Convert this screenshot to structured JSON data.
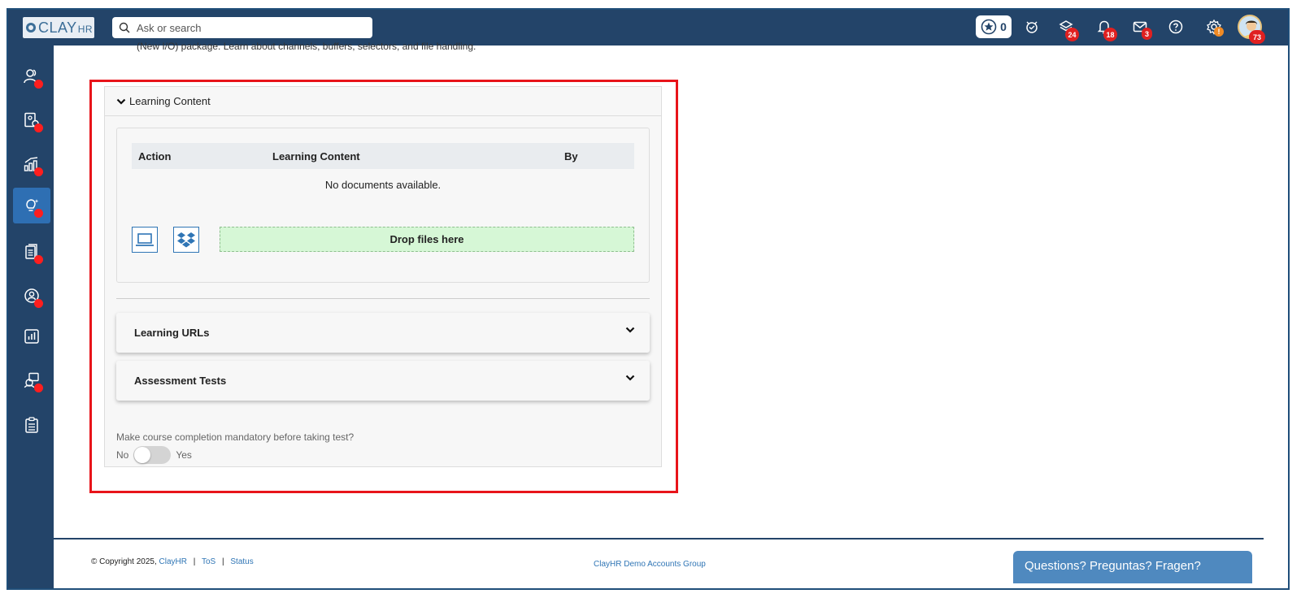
{
  "app": {
    "logo_text": "CLAY",
    "logo_suffix": "HR"
  },
  "search": {
    "placeholder": "Ask or search",
    "value": ""
  },
  "topbar": {
    "star_count": "0",
    "icons": [
      {
        "name": "alarm-icon",
        "badge": ""
      },
      {
        "name": "layers-icon",
        "badge": "24"
      },
      {
        "name": "bell-icon",
        "badge": "18"
      },
      {
        "name": "mail-icon",
        "badge": "3"
      },
      {
        "name": "help-icon",
        "badge": ""
      },
      {
        "name": "settings-icon",
        "badge": "!"
      }
    ],
    "avatar_badge": "73"
  },
  "sidebar": {
    "items": [
      {
        "name": "people-icon",
        "dot": true,
        "active": false
      },
      {
        "name": "document-person-icon",
        "dot": true,
        "active": false
      },
      {
        "name": "growth-chart-icon",
        "dot": true,
        "active": false
      },
      {
        "name": "learning-bulb-icon",
        "dot": true,
        "active": true
      },
      {
        "name": "documents-icon",
        "dot": true,
        "active": false
      },
      {
        "name": "user-circle-icon",
        "dot": true,
        "active": false
      },
      {
        "name": "report-chart-icon",
        "dot": false,
        "active": false
      },
      {
        "name": "support-chat-icon",
        "dot": true,
        "active": false
      },
      {
        "name": "clipboard-icon",
        "dot": false,
        "active": false
      }
    ]
  },
  "content": {
    "cut_text": "(New I/O) package. Learn about channels, buffers, selectors, and file handling.",
    "learning_content": {
      "title": "Learning Content",
      "columns": [
        "Action",
        "Learning Content",
        "By"
      ],
      "empty_message": "No documents available.",
      "drop_label": "Drop files here"
    },
    "learning_urls_title": "Learning URLs",
    "assessment_tests_title": "Assessment Tests",
    "mandatory_question": "Make course completion mandatory before taking test?",
    "toggle_no": "No",
    "toggle_yes": "Yes"
  },
  "footer": {
    "copyright": "© Copyright 2025,",
    "clayhr_link": "ClayHR",
    "tos": "ToS",
    "status": "Status",
    "group": "ClayHR Demo Accounts Group",
    "help_button": "Questions? Preguntas? Fragen?"
  }
}
